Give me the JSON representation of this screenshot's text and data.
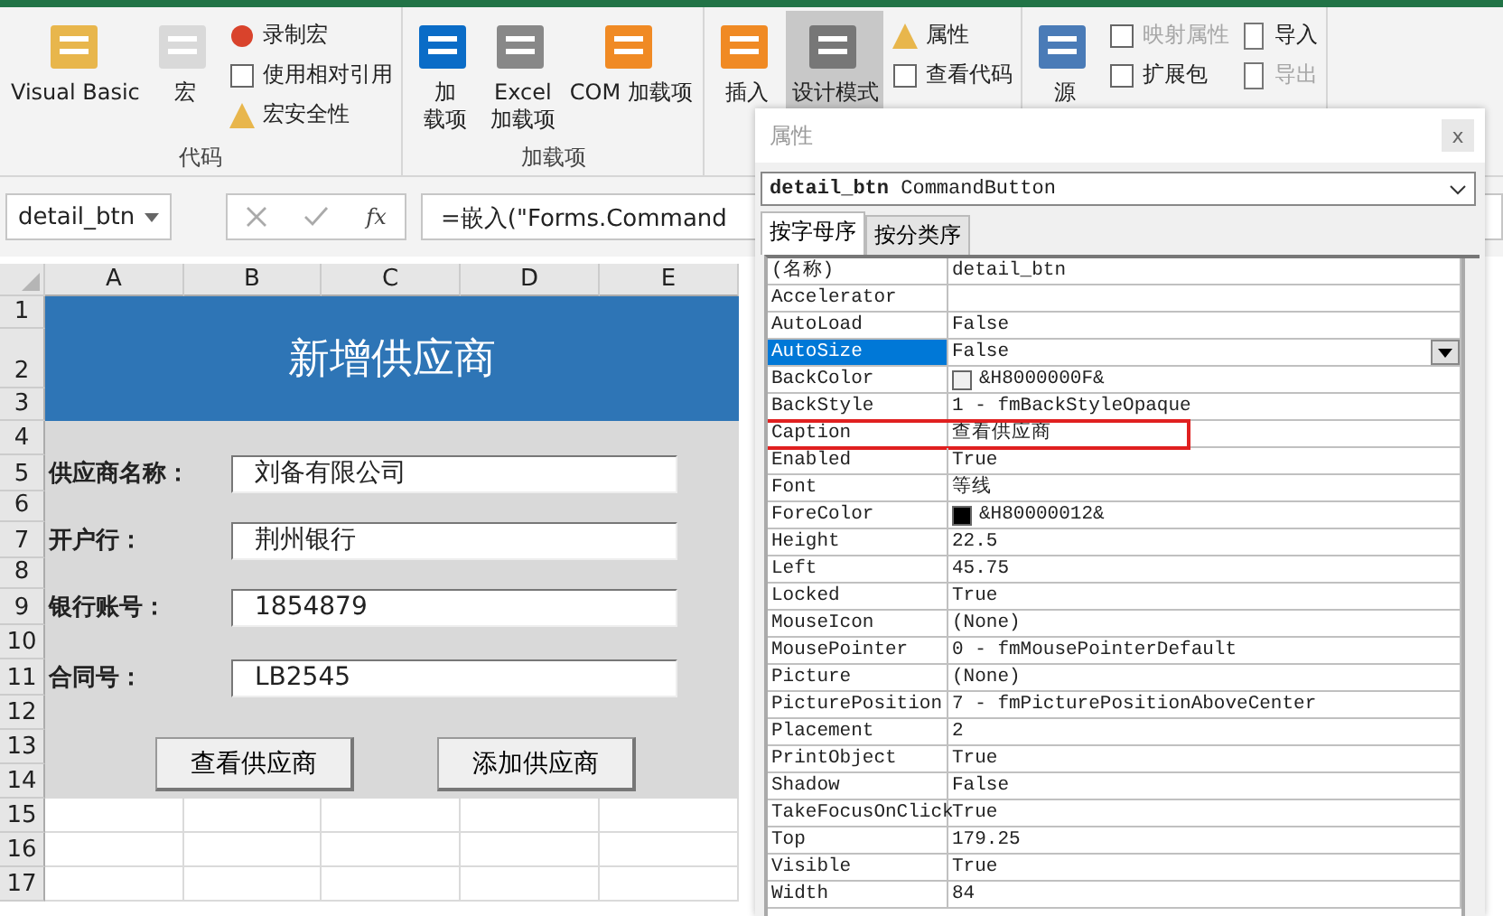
{
  "ribbon": {
    "groups": [
      {
        "label": "代码",
        "large": [
          {
            "label": "Visual Basic",
            "selected": false
          },
          {
            "label": "宏",
            "selected": false
          }
        ],
        "small": [
          {
            "label": "录制宏",
            "disabled": false
          },
          {
            "label": "使用相对引用",
            "disabled": false
          },
          {
            "label": "宏安全性",
            "disabled": false
          }
        ]
      },
      {
        "label": "加载项",
        "large": [
          {
            "lines": [
              "加",
              "载项"
            ],
            "selected": false
          },
          {
            "lines": [
              "Excel",
              "加载项"
            ],
            "selected": false
          },
          {
            "label": "COM 加载项",
            "selected": false
          }
        ]
      },
      {
        "large": [
          {
            "label": "插入",
            "selected": false
          },
          {
            "label": "设计模式",
            "selected": true
          }
        ],
        "small": [
          {
            "label": "属性",
            "disabled": false
          },
          {
            "label": "查看代码",
            "disabled": false
          }
        ]
      },
      {
        "large": [
          {
            "label": "源",
            "selected": false
          }
        ],
        "small": [
          {
            "label": "映射属性",
            "disabled": true
          },
          {
            "label": "扩展包",
            "disabled": false
          }
        ],
        "small2": [
          {
            "label": "导入",
            "disabled": false
          },
          {
            "label": "导出",
            "disabled": true
          }
        ]
      }
    ]
  },
  "formula_bar": {
    "name_box": "detail_btn",
    "function_label": "fx",
    "formula": "=嵌入(\"Forms.Command"
  },
  "sheet": {
    "columns": [
      "A",
      "B",
      "C",
      "D",
      "E"
    ],
    "rows": [
      "1",
      "2",
      "3",
      "4",
      "5",
      "6",
      "7",
      "8",
      "9",
      "10",
      "11",
      "12",
      "13",
      "14",
      "15",
      "16",
      "17"
    ],
    "form": {
      "title": "新增供应商",
      "fields": [
        {
          "label": "供应商名称：",
          "value": "刘备有限公司"
        },
        {
          "label": "开户行：",
          "value": "荆州银行"
        },
        {
          "label": "银行账号：",
          "value": "1854879"
        },
        {
          "label": "合同号：",
          "value": "LB2545"
        }
      ],
      "buttons": [
        "查看供应商",
        "添加供应商"
      ]
    }
  },
  "properties": {
    "title": "属性",
    "close": "x",
    "object_name": "detail_btn",
    "object_type": "CommandButton",
    "tabs": [
      {
        "label": "按字母序",
        "selected": true
      },
      {
        "label": "按分类序",
        "selected": false
      }
    ],
    "rows": [
      {
        "name": "(名称)",
        "value": "detail_btn",
        "selected": false,
        "highlighted": false
      },
      {
        "name": "Accelerator",
        "selected": false,
        "highlighted": false
      },
      {
        "name": "AutoLoad",
        "value": "False",
        "selected": false,
        "highlighted": false
      },
      {
        "name": "AutoSize",
        "value": "False",
        "selected": true,
        "highlighted": false
      },
      {
        "name": "BackColor",
        "value": "&H8000000F&",
        "color": "#f0f0f0",
        "selected": false,
        "highlighted": false
      },
      {
        "name": "BackStyle",
        "value": "1 - fmBackStyleOpaque",
        "selected": false,
        "highlighted": false
      },
      {
        "name": "Caption",
        "value": "查看供应商",
        "selected": false,
        "highlighted": true
      },
      {
        "name": "Enabled",
        "value": "True",
        "selected": false,
        "highlighted": false
      },
      {
        "name": "Font",
        "value": "等线",
        "selected": false,
        "highlighted": false
      },
      {
        "name": "ForeColor",
        "value": "&H80000012&",
        "color": "#000000",
        "selected": false,
        "highlighted": false
      },
      {
        "name": "Height",
        "value": "22.5",
        "selected": false,
        "highlighted": false
      },
      {
        "name": "Left",
        "value": "45.75",
        "selected": false,
        "highlighted": false
      },
      {
        "name": "Locked",
        "value": "True",
        "selected": false,
        "highlighted": false
      },
      {
        "name": "MouseIcon",
        "value": "(None)",
        "selected": false,
        "highlighted": false
      },
      {
        "name": "MousePointer",
        "value": "0 - fmMousePointerDefault",
        "selected": false,
        "highlighted": false
      },
      {
        "name": "Picture",
        "value": "(None)",
        "selected": false,
        "highlighted": false
      },
      {
        "name": "PicturePosition",
        "value": "7 - fmPicturePositionAboveCenter",
        "selected": false,
        "highlighted": false
      },
      {
        "name": "Placement",
        "value": "2",
        "selected": false,
        "highlighted": false
      },
      {
        "name": "PrintObject",
        "value": "True",
        "selected": false,
        "highlighted": false
      },
      {
        "name": "Shadow",
        "value": "False",
        "selected": false,
        "highlighted": false
      },
      {
        "name": "TakeFocusOnClick",
        "value": "True",
        "selected": false,
        "highlighted": false
      },
      {
        "name": "Top",
        "value": "179.25",
        "selected": false,
        "highlighted": false
      },
      {
        "name": "Visible",
        "value": "True",
        "selected": false,
        "highlighted": false
      },
      {
        "name": "Width",
        "value": "84",
        "selected": false,
        "highlighted": false
      }
    ]
  }
}
